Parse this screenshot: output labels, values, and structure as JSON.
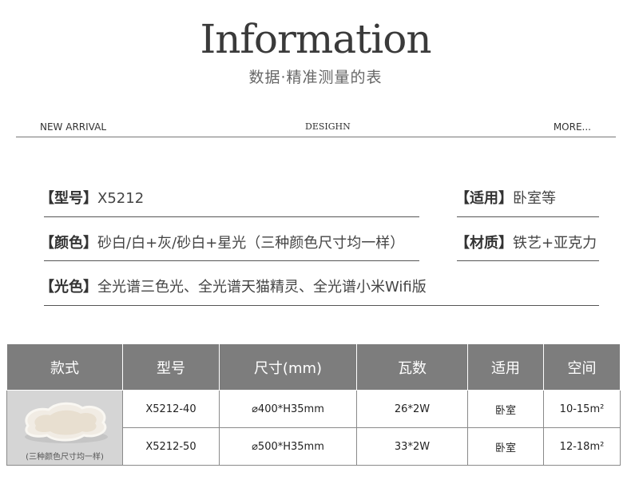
{
  "header": {
    "title": "Information",
    "subtitle": "数据·精准测量的表"
  },
  "nav": {
    "left": "NEW ARRIVAL",
    "center": "DESIGHN",
    "right": "MORE..."
  },
  "specs": {
    "model_key": "【型号】",
    "model_val": "X5212",
    "use_key": "【适用】",
    "use_val": "卧室等",
    "color_key": "【颜色】",
    "color_val": "砂白/白+灰/砂白+星光（三种颜色尺寸均一样）",
    "material_key": "【材质】",
    "material_val": "铁艺+亚克力",
    "light_key": "【光色】",
    "light_val": "全光谱三色光、全光谱天猫精灵、全光谱小米Wifi版"
  },
  "table": {
    "headers": [
      "款式",
      "型号",
      "尺寸(mm)",
      "瓦数",
      "适用",
      "空间"
    ],
    "image_caption": "(三种颜色尺寸均一样)",
    "rows": [
      {
        "model": "X5212-40",
        "size": "⌀400*H35mm",
        "watt": "26*2W",
        "room": "卧室",
        "space": "10-15m²"
      },
      {
        "model": "X5212-50",
        "size": "⌀500*H35mm",
        "watt": "33*2W",
        "room": "卧室",
        "space": "12-18m²"
      }
    ]
  },
  "colors": {
    "header_bg": "#7d7d7d",
    "image_bg": "#d5d5d5"
  }
}
